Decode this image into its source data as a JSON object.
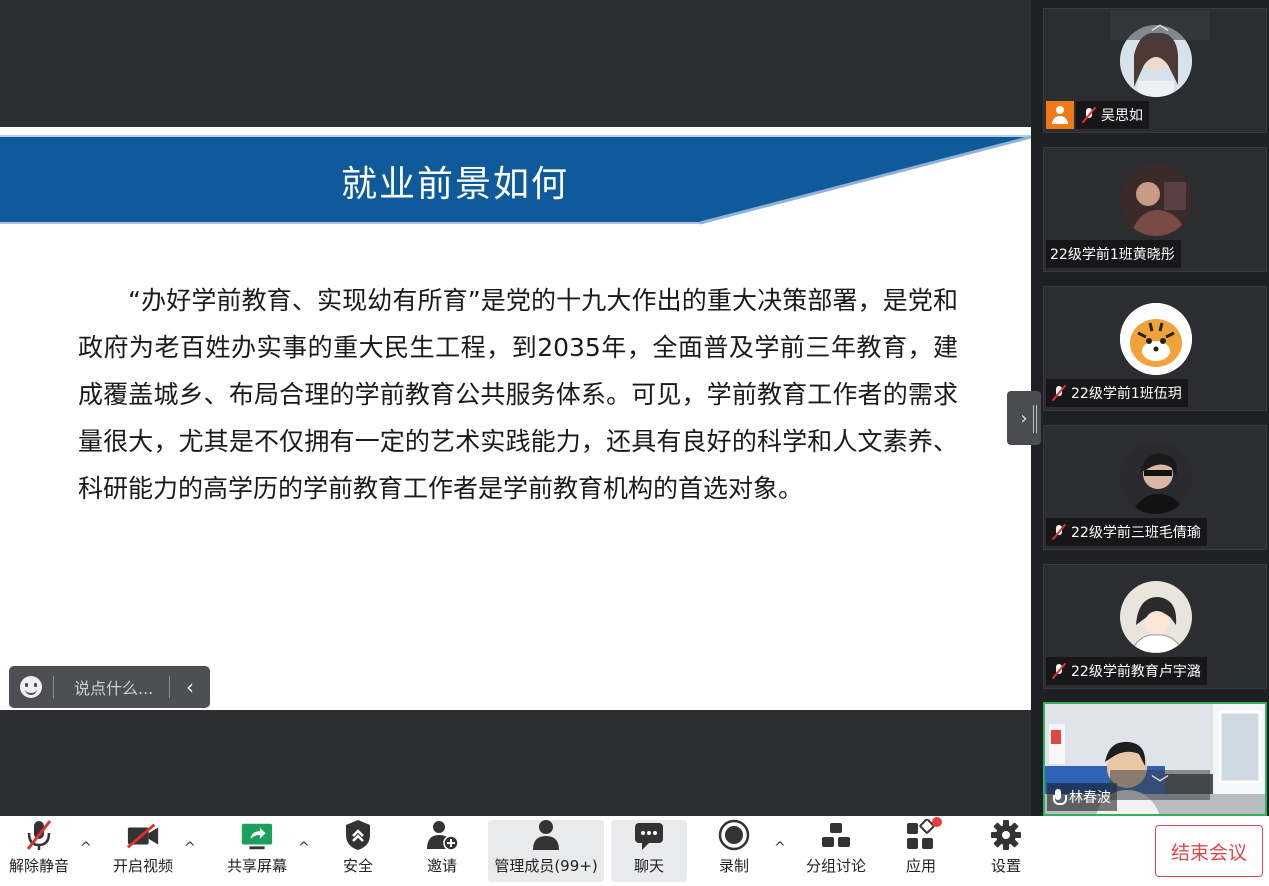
{
  "slide": {
    "title": "就业前景如何",
    "body": "“办好学前教育、实现幼有所育”是党的十九大作出的重大决策部署，是党和政府为老百姓办实事的重大民生工程，到2035年，全面普及学前三年教育，建成覆盖城乡、布局合理的学前教育公共服务体系。可见，学前教育工作者的需求量很大，尤其是不仅拥有一定的艺术实践能力，还具有良好的科学和人文素养、科研能力的高学历的学前教育工作者是学前教育机构的首选对象。"
  },
  "chat": {
    "placeholder": "说点什么...",
    "collapse_icon": "‹"
  },
  "participants": [
    {
      "name": "吴思如",
      "mic": "muted",
      "host_badge": true
    },
    {
      "name": "22级学前1班黄晓彤",
      "mic": "none"
    },
    {
      "name": "22级学前1班伍玥",
      "mic": "muted"
    },
    {
      "name": "22级学前三班毛倩瑜",
      "mic": "muted"
    },
    {
      "name": "22级学前教育卢宇潞",
      "mic": "muted"
    },
    {
      "name": "林春波",
      "mic": "on",
      "video": true
    }
  ],
  "panel": {
    "scroll_up": "︿",
    "scroll_down": "﹀",
    "toggle": "›"
  },
  "toolbar": {
    "unmute": "解除静音",
    "start_video": "开启视频",
    "share_screen": "共享屏幕",
    "security": "安全",
    "invite": "邀请",
    "manage_members": "管理成员(99+)",
    "chat": "聊天",
    "record": "录制",
    "breakout": "分组讨论",
    "apps": "应用",
    "settings": "设置",
    "end_meeting": "结束会议",
    "caret": "^"
  },
  "colors": {
    "banner_blue": "#0f5a9a",
    "end_red": "#e0494a",
    "share_green": "#1aa05a",
    "notify_red": "#ee3a3a"
  }
}
